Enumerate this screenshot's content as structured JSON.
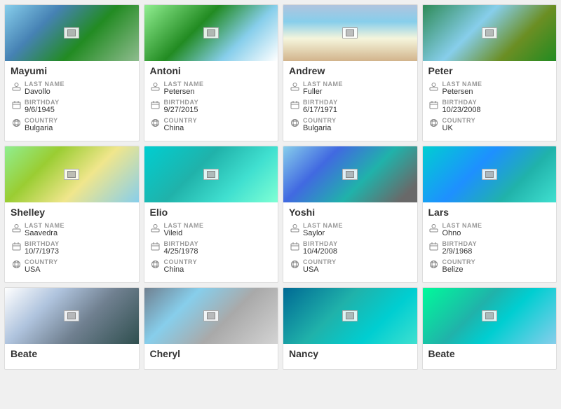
{
  "cards": [
    {
      "id": "mayumi",
      "name": "Mayumi",
      "image_class": "img-mountains",
      "last_name": "Davollo",
      "birthday": "9/6/1945",
      "country": "Bulgaria"
    },
    {
      "id": "antoni",
      "name": "Antoni",
      "image_class": "img-hills-green",
      "last_name": "Petersen",
      "birthday": "9/27/2015",
      "country": "China"
    },
    {
      "id": "andrew",
      "name": "Andrew",
      "image_class": "img-beach-aerial",
      "last_name": "Fuller",
      "birthday": "6/17/1971",
      "country": "Bulgaria"
    },
    {
      "id": "peter",
      "name": "Peter",
      "image_class": "img-mountains2",
      "last_name": "Petersen",
      "birthday": "10/23/2008",
      "country": "UK"
    },
    {
      "id": "shelley",
      "name": "Shelley",
      "image_class": "img-map-green",
      "last_name": "Saavedra",
      "birthday": "10/7/1973",
      "country": "USA"
    },
    {
      "id": "elio",
      "name": "Elio",
      "image_class": "img-turquoise",
      "last_name": "Vileid",
      "birthday": "4/25/1978",
      "country": "China"
    },
    {
      "id": "yoshi",
      "name": "Yoshi",
      "image_class": "img-island",
      "last_name": "Saylor",
      "birthday": "10/4/2008",
      "country": "USA"
    },
    {
      "id": "lars",
      "name": "Lars",
      "image_class": "img-ocean-boats",
      "last_name": "Ohno",
      "birthday": "2/9/1968",
      "country": "Belize"
    },
    {
      "id": "beate1",
      "name": "Beate",
      "image_class": "img-snow-mountain",
      "last_name": "",
      "birthday": "",
      "country": ""
    },
    {
      "id": "cheryl",
      "name": "Cheryl",
      "image_class": "img-ruins",
      "last_name": "",
      "birthday": "",
      "country": ""
    },
    {
      "id": "nancy",
      "name": "Nancy",
      "image_class": "img-underwater",
      "last_name": "",
      "birthday": "",
      "country": ""
    },
    {
      "id": "beate2",
      "name": "Beate",
      "image_class": "img-lagoon",
      "last_name": "",
      "birthday": "",
      "country": ""
    }
  ],
  "labels": {
    "last_name": "LAST NAME",
    "birthday": "BIRTHDAY",
    "country": "COUNTRY"
  }
}
